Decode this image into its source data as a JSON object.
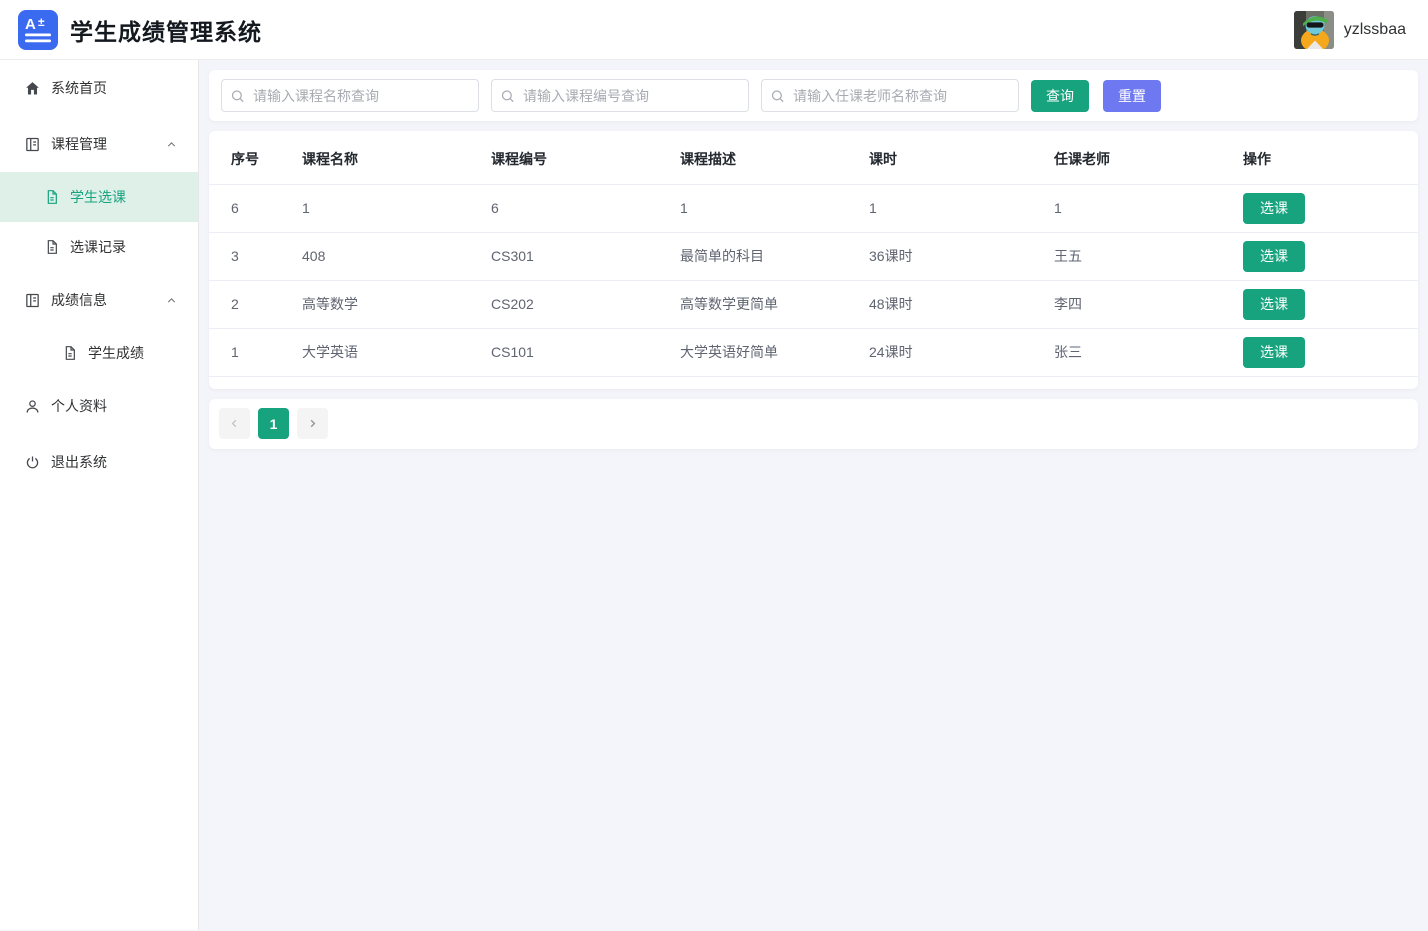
{
  "header": {
    "title": "学生成绩管理系统",
    "username": "yzlssbaa"
  },
  "sidebar": {
    "items": [
      {
        "label": "系统首页"
      },
      {
        "label": "课程管理"
      },
      {
        "label": "学生选课"
      },
      {
        "label": "选课记录"
      },
      {
        "label": "成绩信息"
      },
      {
        "label": "学生成绩"
      },
      {
        "label": "个人资料"
      },
      {
        "label": "退出系统"
      }
    ]
  },
  "search": {
    "placeholders": [
      "请输入课程名称查询",
      "请输入课程编号查询",
      "请输入任课老师名称查询"
    ],
    "query_label": "查询",
    "reset_label": "重置"
  },
  "table": {
    "columns": [
      "序号",
      "课程名称",
      "课程编号",
      "课程描述",
      "课时",
      "任课老师",
      "操作"
    ],
    "rows": [
      {
        "seq": "6",
        "name": "1",
        "code": "6",
        "desc": "1",
        "hours": "1",
        "teacher": "1"
      },
      {
        "seq": "3",
        "name": "408",
        "code": "CS301",
        "desc": "最简单的科目",
        "hours": "36课时",
        "teacher": "王五"
      },
      {
        "seq": "2",
        "name": "高等数学",
        "code": "CS202",
        "desc": "高等数学更简单",
        "hours": "48课时",
        "teacher": "李四"
      },
      {
        "seq": "1",
        "name": "大学英语",
        "code": "CS101",
        "desc": "大学英语好简单",
        "hours": "24课时",
        "teacher": "张三"
      }
    ],
    "action_label": "选课"
  },
  "pagination": {
    "current_page": "1"
  },
  "colors": {
    "primary_green": "#17a37e",
    "active_item_bg": "#dff0e9",
    "reset_purple": "#6e78f0",
    "logo_blue": "#3a6af0",
    "main_bg": "#f4f5fa"
  }
}
